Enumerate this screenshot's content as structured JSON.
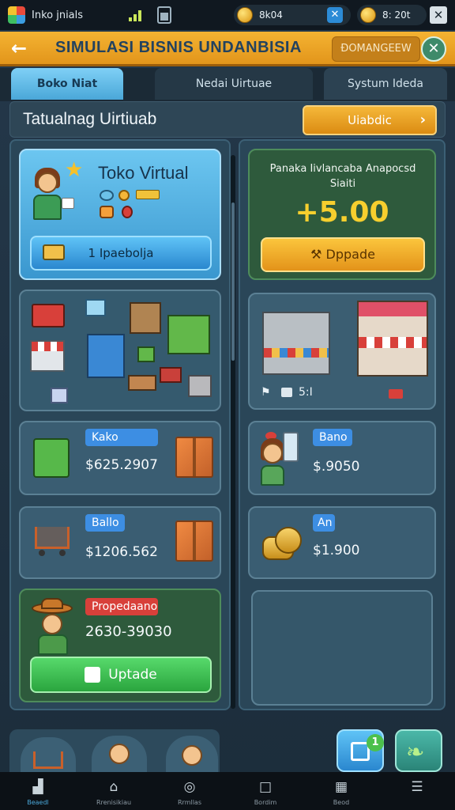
{
  "status_bar": {
    "app_name": "Inko jnials",
    "currency_a": "8k04",
    "currency_b": "8: 20t"
  },
  "header": {
    "title": "SIMULASI BISNIS UNDANBISIA",
    "action_label": "ĐOMANGEEW"
  },
  "tabs": [
    {
      "label": "Boko Niat"
    },
    {
      "label": "Nedai Uirtuae"
    },
    {
      "label": "Systum Ideda"
    }
  ],
  "page": {
    "title": "Tatualnag Uirtiuab",
    "update_button": "Uiabdic"
  },
  "shop_card": {
    "title": "Toko Virtual",
    "button_label": "1 Ipaebolja"
  },
  "balance_card": {
    "caption": "Panaka Iivlancaba Anapocsd Siaiti",
    "amount": "+5.00",
    "button_label": "Dppade"
  },
  "building_panel": {
    "caption": "5:I"
  },
  "item_cards": [
    {
      "label": "Kako",
      "price": "$625.2907"
    },
    {
      "label": "Bano",
      "price": "$.9050"
    },
    {
      "label": "Ballo",
      "price": "$1206.562"
    },
    {
      "label": "An",
      "price": "$1.900"
    }
  ],
  "promo_card": {
    "label": "Propedaano",
    "range": "2630-39030",
    "button_label": "Uptade"
  },
  "nav": [
    {
      "label": "Beaedl"
    },
    {
      "label": "Rrenisikiau"
    },
    {
      "label": "Rrmllas"
    },
    {
      "label": "Bordim"
    },
    {
      "label": "Beod"
    },
    {
      "label": ""
    }
  ],
  "floating": {
    "notification_count": "1"
  },
  "colors": {
    "header": "#e9a42a",
    "tab_active": "#5db9e6",
    "card_blue": "#4aa7d8",
    "card_green": "#2e5a3c",
    "accent_orange": "#f1a623",
    "accent_green": "#3fbf55"
  }
}
